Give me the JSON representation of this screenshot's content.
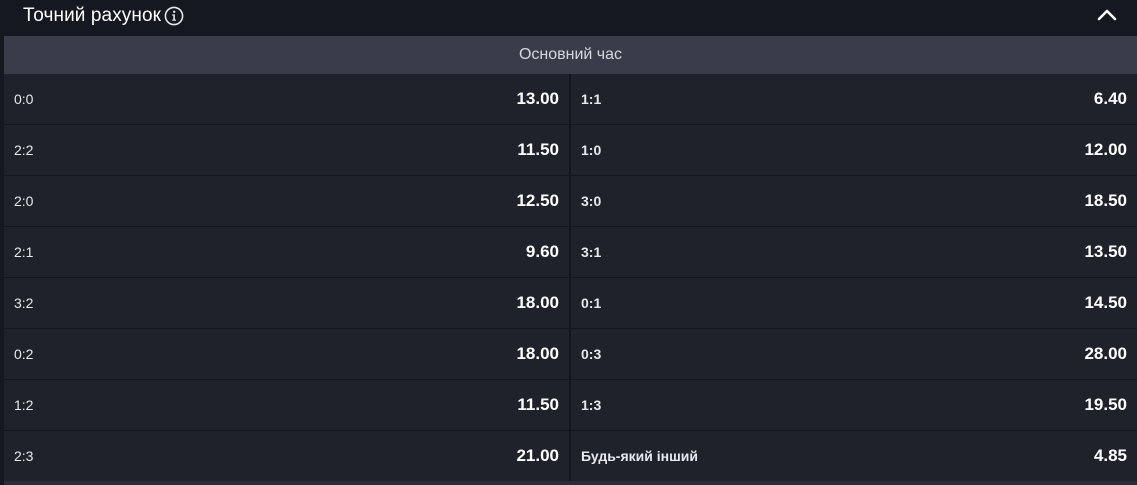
{
  "header": {
    "title": "Точний рахунок",
    "info_icon": "info-icon",
    "collapse_icon": "chevron-up-icon"
  },
  "period": {
    "label": "Основний час"
  },
  "colors": {
    "background": "#161821",
    "cell": "#1f212b",
    "period_bar": "#3a3d49",
    "text": "#ffffff"
  },
  "rows": [
    {
      "left": {
        "score": "0:0",
        "odd": "13.00"
      },
      "right": {
        "score": "1:1",
        "odd": "6.40"
      }
    },
    {
      "left": {
        "score": "2:2",
        "odd": "11.50"
      },
      "right": {
        "score": "1:0",
        "odd": "12.00"
      }
    },
    {
      "left": {
        "score": "2:0",
        "odd": "12.50"
      },
      "right": {
        "score": "3:0",
        "odd": "18.50"
      }
    },
    {
      "left": {
        "score": "2:1",
        "odd": "9.60"
      },
      "right": {
        "score": "3:1",
        "odd": "13.50"
      }
    },
    {
      "left": {
        "score": "3:2",
        "odd": "18.00"
      },
      "right": {
        "score": "0:1",
        "odd": "14.50"
      }
    },
    {
      "left": {
        "score": "0:2",
        "odd": "18.00"
      },
      "right": {
        "score": "0:3",
        "odd": "28.00"
      }
    },
    {
      "left": {
        "score": "1:2",
        "odd": "11.50"
      },
      "right": {
        "score": "1:3",
        "odd": "19.50"
      }
    },
    {
      "left": {
        "score": "2:3",
        "odd": "21.00"
      },
      "right": {
        "score": "Будь-який інший",
        "odd": "4.85"
      }
    }
  ]
}
